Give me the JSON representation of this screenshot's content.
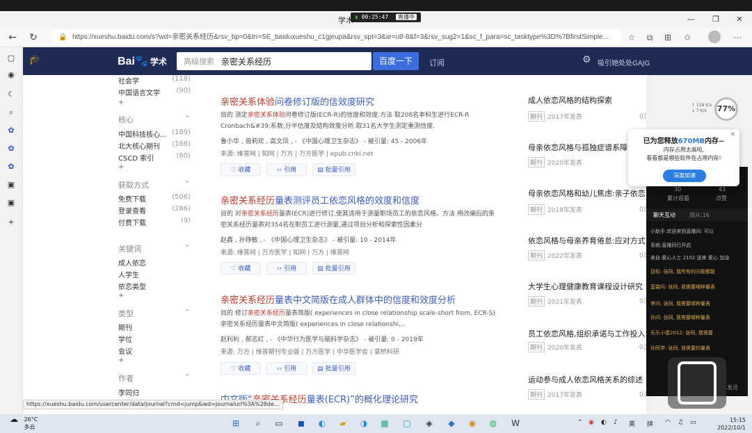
{
  "recording": {
    "time": "00:25:47",
    "badge": "直播中"
  },
  "window": {
    "tab_title": "学术"
  },
  "address": {
    "url": "https://xueshu.baidu.com/s?wd=亲密关系经历&rsv_bp=0&tn=SE_baiduxueshu_c1gjeupa&rsv_spt=3&ie=utf-8&f=3&rsv_sug2=1&sc_f_para=sc_tasktype%3D%7BfirstSimple..."
  },
  "header": {
    "logo": "Bai",
    "logo_paw": "🐾",
    "logo_xs": "学术",
    "search_mode": "高级搜索",
    "search_value": "亲密关系经历",
    "search_button": "百度一下",
    "subscribe": "订阅",
    "user": "吸引她处处GAJG"
  },
  "filters": {
    "top_items": [
      {
        "label": "社会学",
        "count": "(118)"
      },
      {
        "label": "中国语言文学",
        "count": "(90)"
      }
    ],
    "core_title": "核心",
    "core_items": [
      {
        "label": "中国科技核心...",
        "count": "(189)"
      },
      {
        "label": "北大核心期刊",
        "count": "(166)"
      },
      {
        "label": "CSCD 索引",
        "count": "(80)"
      }
    ],
    "access_title": "获取方式",
    "access_items": [
      {
        "label": "免费下载",
        "count": "(506)"
      },
      {
        "label": "登录查看",
        "count": "(286)"
      },
      {
        "label": "付费下载",
        "count": "(9)"
      }
    ],
    "keyword_title": "关键词",
    "keyword_items": [
      "成人依恋",
      "人学生",
      "依恋类型"
    ],
    "type_title": "类型",
    "type_items": [
      "期刊",
      "学位",
      "会议"
    ],
    "author_title": "作者",
    "author_items": [
      "李同归"
    ],
    "plus": "+"
  },
  "results": [
    {
      "title_hl": "亲密关系体验",
      "title_rest": "问卷修订版的信效度研究",
      "abs1_pre": "目的 测定",
      "abs1_hl": "亲密关系体验",
      "abs1_post": "问卷修订版(ECR-R)的信度和效度.方法 取208名本科生进行ECR-R",
      "abs2": "Cronbach&#39;系数,分半信度及结构效度分析,取31名大学生测定重测信度.",
      "meta": "鲁小华 ,  曾莉欢 ,  高文凤 ,   -  《中国心理卫生杂志》  - 被引量: 45  - 2006年",
      "src": "来源:  维普网  |  知网  |  万方  |  万方医学  |  epub.cnki.net"
    },
    {
      "title_hl": "亲密关系经历",
      "title_rest": "量表测评员工依恋风格的效度和信度",
      "abs1_pre": "目的 对",
      "abs1_hl": "亲密关系经历",
      "abs1_post": "量表(ECR)进行修订,使其适用于测量职场员工的依恋风格。方法 用改编后的亲",
      "abs2": "密关系经历量表对354名在职员工进行测量,通过项目分析和探索性因素分",
      "meta": "赵鑫 ,  孙铮敏 ,  -  《中国心理卫生杂志》  - 被引量: 10  - 2014年",
      "src": "来源:  维普网  |  万方医学  |  知网  |  万方  |  维普网"
    },
    {
      "title_hl": "亲密关系经历",
      "title_rest": "量表中文简版在成人群体中的信度和效度分析",
      "abs1_pre": "目的 修订",
      "abs1_hl": "亲密关系经历",
      "abs1_post": "量表简版( experiences in close relationship scale-short from, ECR-S)并分析",
      "abs2": "亲密关系经历量表中文简版( experiences in close relationshi...",
      "meta": "赵利利 ,  郝志红 ,  -  《中华行为医学与脑科学杂志》  - 被引量: 0  - 2019年",
      "src": "来源:  万方  |  维普期刊专业版  |  万方医学  |  中华医学会  |  掌桥科研"
    },
    {
      "title_pre": "中文版“",
      "title_hl": "亲密关系经历",
      "title_rest": "量表(ECR)”的概化理论研究"
    }
  ],
  "actions": {
    "collect": "收藏",
    "cite": "引用",
    "batch": "批量引用"
  },
  "related": [
    {
      "title": "成人依恋风格的结构探索",
      "tag": "期刊",
      "year": "2017年发表",
      "read": "0次被引"
    },
    {
      "title": "母亲依恋风格与孤独症谱系障",
      "tag": "期刊",
      "year": "2020年发表",
      "read": ""
    },
    {
      "title": "母亲依恋风格和幼儿焦虑:亲子依恋",
      "tag": "期刊",
      "year": "2018年发表",
      "read": "0次被"
    },
    {
      "title": "依恋风格与母亲养育倦怠:应对方式",
      "tag": "期刊",
      "year": "2022年发表",
      "read": "0次被"
    },
    {
      "title": "大学生心理健康教育课程设计研究",
      "tag": "期刊",
      "year": "2021年发表",
      "read": "0次被引"
    },
    {
      "title": "员工依恋风格,组织承诺与工作投入",
      "tag": "期刊",
      "year": "2020年发表",
      "read": "0次被"
    },
    {
      "title": "运动参与成人依恋风格关系的综述",
      "tag": "期刊",
      "year": "2017年发表",
      "read": "0次被"
    }
  ],
  "mempop": {
    "t1_pre": "已为您释放",
    "t1_bold": "670MB",
    "t1_post": "内存~",
    "t2a": "内存占用太高啦,",
    "t2b": "看看都是哪些软件在占用内存!",
    "button": "深度加速"
  },
  "speed": {
    "percent": "77%",
    "up": "↑ 158 K/s",
    "down": "↓ 7  K/s"
  },
  "live": {
    "stat1": "30",
    "stat1_label": "累计观看",
    "stat2": "43",
    "stat2_label": "点赞",
    "tab1": "聊天互动",
    "tab2": "观众:16",
    "msgs": [
      {
        "t": "小助手:欢迎来到直播间: 可以",
        "c": "w"
      },
      {
        "t": "系统:直播间已开启",
        "c": "w"
      },
      {
        "t": "来自:爱心人士 2102 送来 爱心 加油",
        "c": "w"
      },
      {
        "t": "目标: 张同, 我所有的问题都能",
        "c": "y"
      },
      {
        "t": "蓝霜问: 张同, 我需要哪种量表",
        "c": "y"
      },
      {
        "t": "李问: 张同, 我需要哪种量表",
        "c": "y"
      },
      {
        "t": "孙问: 张同, 我需要哪种量表",
        "c": "y"
      },
      {
        "t": "乐乐小蛋2012: 张同, 我需要",
        "c": "y"
      },
      {
        "t": "孙同学: 张同, 我需要的量表",
        "c": "y"
      }
    ],
    "footer": "发送"
  },
  "status_url": "https://xueshu.baidu.com/usercenter/data/journal?cmd=jump&wd=journalurl%3A%28de...",
  "taskbar": {
    "temp": "26°C",
    "weather": "多云",
    "ime1": "英",
    "ime2": "拼",
    "time": "15:15",
    "date": "2022/10/1"
  }
}
